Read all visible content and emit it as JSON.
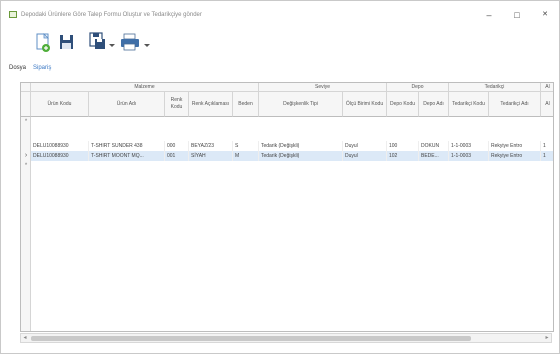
{
  "window": {
    "title": "Depodaki Ürünlere Göre Talep Formu Oluştur ve Tedarikçiye gönder",
    "minimize": "–",
    "maximize": "□",
    "close": "✕"
  },
  "toolbar": {
    "icons": [
      "new-document-icon",
      "save-icon",
      "save-as-icon",
      "dropdown-arrow-icon",
      "print-icon",
      "dropdown-arrow-icon"
    ]
  },
  "menu": {
    "items": [
      "Dosya",
      "Sipariş"
    ]
  },
  "grid": {
    "bands": [
      "Malzeme",
      "Seviye",
      "Depo",
      "Tedarikçi",
      "Al"
    ],
    "columns": [
      "Ürün Kodu",
      "Ürün Adı",
      "Renk Kodu",
      "Renk Açıklaması",
      "Beden",
      "Değişkenlik Tipi",
      "Ölçü Birimi Kodu",
      "Depo Kodu",
      "Depo Adı",
      "Tedarikçi Kodu",
      "Tedarikçi Adı",
      "Al"
    ],
    "new_row_marker": "*",
    "rows": [
      {
        "indicator": "",
        "cells": [
          "DELU10088930",
          "T-SHIRT SUNDER 438",
          "000",
          "BEYAZ/23",
          "S",
          "Tedarik (Değişkli)",
          "Duyul",
          "100",
          "DOKUN",
          "1-1-0003",
          "Rekyiye Entro",
          "1"
        ]
      },
      {
        "indicator": "›",
        "cells": [
          "DELU10088930",
          "T-SHIRT MOONT MQ...",
          "001",
          "SİYAH",
          "M",
          "Tedarik (Değişkli)",
          "Duyul",
          "102",
          "BEDE...",
          "1-1-0003",
          "Rekyiye Entro",
          "1"
        ]
      }
    ],
    "trailing_marker": "*"
  },
  "scrollbar": {
    "left_arrow": "◂",
    "right_arrow": "▸"
  }
}
